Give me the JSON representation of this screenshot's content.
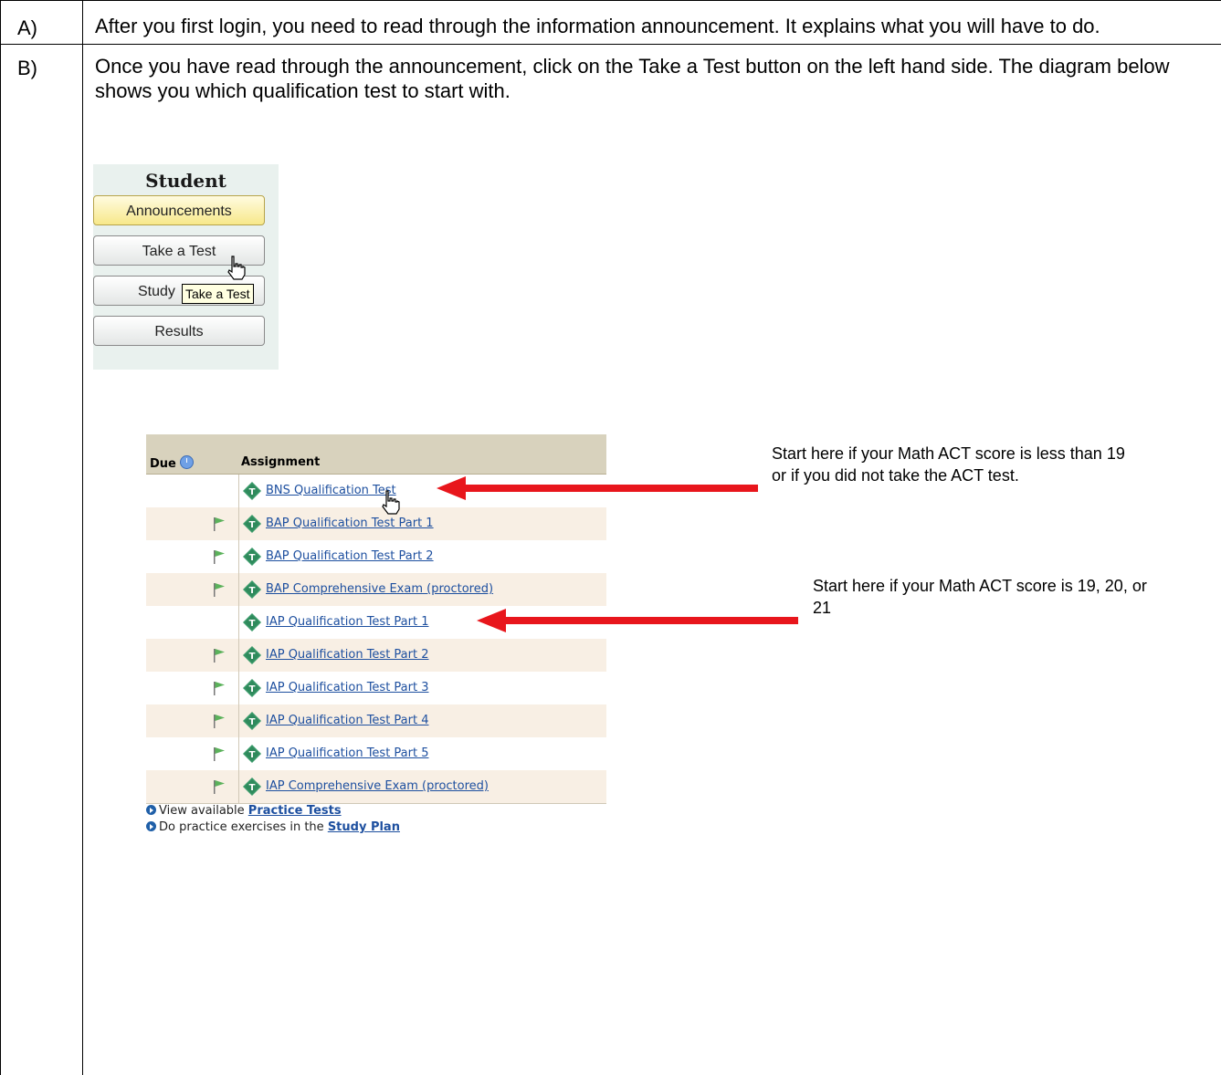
{
  "steps": [
    {
      "label": "A)",
      "text": "After you first login, you need to read through the information announcement.  It explains what you will have to do."
    },
    {
      "label": "B)",
      "text": "Once you have read through the announcement, click on the Take a Test button on the left hand side.  The diagram below shows you which qualification test to start with."
    }
  ],
  "student_panel": {
    "title": "Student",
    "buttons": [
      "Announcements",
      "Take a Test",
      "Study",
      "Results"
    ],
    "tooltip": "Take a Test"
  },
  "assignments": {
    "headers": {
      "due": "Due",
      "assignment": "Assignment"
    },
    "rows": [
      {
        "name": "BNS Qualification Test",
        "flag": false
      },
      {
        "name": "BAP Qualification Test Part 1",
        "flag": true
      },
      {
        "name": "BAP Qualification Test Part 2",
        "flag": true
      },
      {
        "name": "BAP Comprehensive Exam (proctored)",
        "flag": true
      },
      {
        "name": "IAP Qualification Test Part 1",
        "flag": false
      },
      {
        "name": "IAP Qualification Test Part 2",
        "flag": true
      },
      {
        "name": "IAP Qualification Test Part 3",
        "flag": true
      },
      {
        "name": "IAP Qualification Test Part 4",
        "flag": true
      },
      {
        "name": "IAP Qualification Test Part 5",
        "flag": true
      },
      {
        "name": "IAP Comprehensive Exam (proctored)",
        "flag": true
      }
    ],
    "footer": [
      {
        "prefix": "View available ",
        "link": "Practice Tests"
      },
      {
        "prefix": "Do practice exercises in the ",
        "link": "Study Plan"
      }
    ]
  },
  "notes": [
    "Start here if your Math ACT score is less than 19 or if you did not take the ACT test.",
    "Start here if your Math ACT score is 19, 20, or 21"
  ],
  "colors": {
    "arrow": "#e8161c",
    "link": "#1d4f9f",
    "header_bg": "#d8d2bd",
    "row_shade": "#f8efe4",
    "icon_green": "#3a9a6a",
    "flag_green": "#5bb25b"
  }
}
